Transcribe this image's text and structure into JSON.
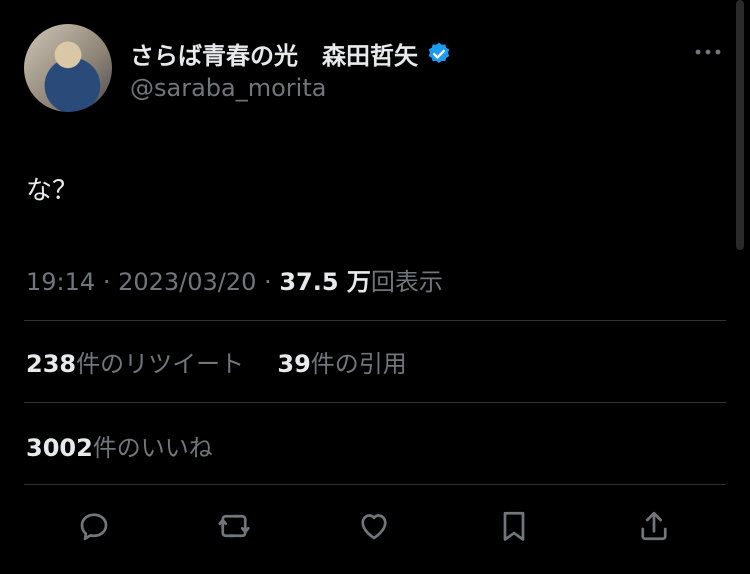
{
  "author": {
    "display_name": "さらば青春の光　森田哲矢",
    "handle": "@saraba_morita",
    "verified": true
  },
  "tweet": {
    "text": "な？",
    "time": "19:14",
    "date": "2023/03/20",
    "views_count": "37.5 万",
    "views_label": "回表示"
  },
  "stats": {
    "retweets_count": "238",
    "retweets_label": "件のリツイート",
    "quotes_count": "39",
    "quotes_label": "件の引用",
    "likes_count": "3002",
    "likes_label": "件のいいね"
  },
  "icons": {
    "more": "more-horizontal-icon",
    "reply": "reply-icon",
    "retweet": "retweet-icon",
    "like": "heart-icon",
    "bookmark": "bookmark-icon",
    "share": "share-icon",
    "verified": "verified-badge-icon"
  },
  "colors": {
    "background": "#000000",
    "text": "#e7e9ea",
    "muted": "#71767b",
    "verified": "#1d9bf0"
  }
}
